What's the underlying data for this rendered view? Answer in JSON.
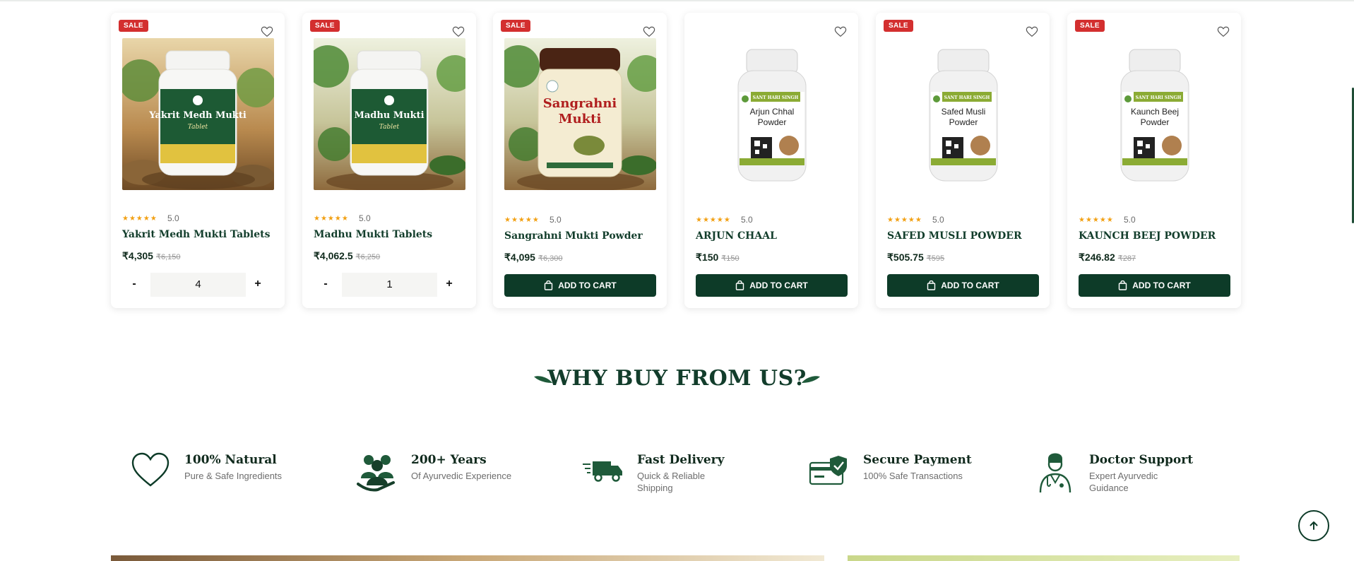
{
  "products": [
    {
      "badge": "SALE",
      "name": "Yakrit Medh Mukti Tablets",
      "rating": "5.0",
      "price": "₹4,305",
      "old_price": "₹6,150",
      "action": "qty",
      "qty": "4",
      "minus": "-",
      "plus": "+",
      "label_line1": "Yakrit Medh Mukti",
      "label_line2": "Tablet",
      "pack": "jar-green",
      "bg": "wood"
    },
    {
      "badge": "SALE",
      "name": "Madhu Mukti Tablets",
      "rating": "5.0",
      "price": "₹4,062.5",
      "old_price": "₹6,250",
      "action": "qty",
      "qty": "1",
      "minus": "-",
      "plus": "+",
      "label_line1": "Madhu Mukti",
      "label_line2": "Tablet",
      "pack": "jar-green",
      "bg": "garden"
    },
    {
      "badge": "SALE",
      "name": "Sangrahni Mukti Powder",
      "rating": "5.0",
      "price": "₹4,095",
      "old_price": "₹6,300",
      "action": "cart",
      "cart_label": "ADD TO CART",
      "label_line1": "Sangrahni",
      "label_line2": "Mukti",
      "pack": "jar-cream",
      "bg": "garden"
    },
    {
      "badge": "",
      "name": "ARJUN CHAAL",
      "rating": "5.0",
      "price": "₹150",
      "old_price": "₹150",
      "action": "cart",
      "cart_label": "ADD TO CART",
      "label_line1": "Arjun Chhal",
      "label_line2": "Powder",
      "pack": "bottle-white",
      "bg": "white"
    },
    {
      "badge": "SALE",
      "name": "SAFED MUSLI POWDER",
      "rating": "5.0",
      "price": "₹505.75",
      "old_price": "₹595",
      "action": "cart",
      "cart_label": "ADD TO CART",
      "label_line1": "Safed Musli",
      "label_line2": "Powder",
      "pack": "bottle-white",
      "bg": "white"
    },
    {
      "badge": "SALE",
      "name": "KAUNCH BEEJ POWDER",
      "rating": "5.0",
      "price": "₹246.82",
      "old_price": "₹287",
      "action": "cart",
      "cart_label": "ADD TO CART",
      "label_line1": "Kaunch Beej",
      "label_line2": "Powder",
      "pack": "bottle-white",
      "bg": "white"
    }
  ],
  "brand_label": "SANT HARI SINGH",
  "why": {
    "title": "WHY BUY FROM US?",
    "features": [
      {
        "icon": "heart-icon",
        "title": "100% Natural",
        "desc": "Pure & Safe Ingredients"
      },
      {
        "icon": "people-icon",
        "title": "200+ Years",
        "desc": "Of Ayurvedic Experience"
      },
      {
        "icon": "delivery-truck-icon",
        "title": "Fast Delivery",
        "desc": "Quick & Reliable Shipping"
      },
      {
        "icon": "secure-card-icon",
        "title": "Secure Payment",
        "desc": "100% Safe Transactions"
      },
      {
        "icon": "doctor-icon",
        "title": "Doctor Support",
        "desc": "Expert Ayurvedic Guidance"
      }
    ]
  },
  "colors": {
    "brand": "#0d3b28",
    "sale": "#d32f2f",
    "star": "#f2a013"
  }
}
